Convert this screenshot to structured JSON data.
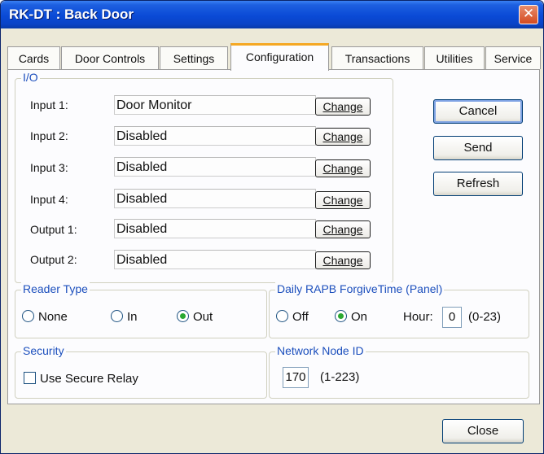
{
  "window": {
    "title": "RK-DT : Back Door",
    "close_glyph": "✕"
  },
  "tabs": [
    {
      "label": "Cards"
    },
    {
      "label": "Door Controls"
    },
    {
      "label": "Settings"
    },
    {
      "label": "Configuration"
    },
    {
      "label": "Transactions"
    },
    {
      "label": "Utilities"
    },
    {
      "label": "Service"
    }
  ],
  "active_tab": "Configuration",
  "io": {
    "label": "I/O",
    "change_label": "Change",
    "rows": [
      {
        "label": "Input 1:",
        "value": "Door Monitor"
      },
      {
        "label": "Input 2:",
        "value": "Disabled"
      },
      {
        "label": "Input 3:",
        "value": "Disabled"
      },
      {
        "label": "Input 4:",
        "value": "Disabled"
      },
      {
        "label": "Output 1:",
        "value": "Disabled"
      },
      {
        "label": "Output 2:",
        "value": "Disabled"
      }
    ]
  },
  "side_buttons": {
    "cancel": "Cancel",
    "send": "Send",
    "refresh": "Refresh"
  },
  "reader_type": {
    "label": "Reader Type",
    "options": [
      "None",
      "In",
      "Out"
    ],
    "selected": "Out"
  },
  "rapb": {
    "label": "Daily RAPB ForgiveTime (Panel)",
    "options": [
      "Off",
      "On"
    ],
    "selected": "On",
    "hour_label": "Hour:",
    "hour_value": "0",
    "hour_range": "(0-23)"
  },
  "security": {
    "label": "Security",
    "use_secure_relay": "Use Secure Relay",
    "checked": false
  },
  "network": {
    "label": "Network Node ID",
    "value": "170",
    "range": "(1-223)"
  },
  "footer": {
    "close": "Close"
  },
  "colors": {
    "title_bar": "#0a4ad6",
    "group_label": "#1c4fbd",
    "active_tab_accent": "#f5a823",
    "radio_selected": "#2aa831"
  }
}
